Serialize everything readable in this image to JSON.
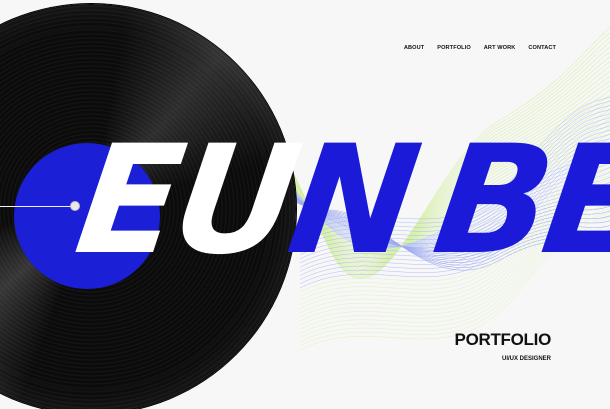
{
  "nav": {
    "items": [
      {
        "label": "ABOUT"
      },
      {
        "label": "PORTFOLIO"
      },
      {
        "label": "ART WORK"
      },
      {
        "label": "CONTACT"
      }
    ]
  },
  "hero": {
    "title_part_white": "EU",
    "title_part_blue_1": "N",
    "title_part_blue_2": "BEE",
    "heading": "PORTFOLIO",
    "subtitle": "UI/UX DESIGNER"
  },
  "colors": {
    "accent_blue": "#1a1ad8",
    "record_black": "#0b0b0b",
    "background": "#f7f7f7",
    "wave_green": "#d6f0a6",
    "wave_blue": "#9aa8f2"
  },
  "icons": {
    "record": "vinyl-record-icon",
    "tonearm": "tonearm-icon"
  }
}
